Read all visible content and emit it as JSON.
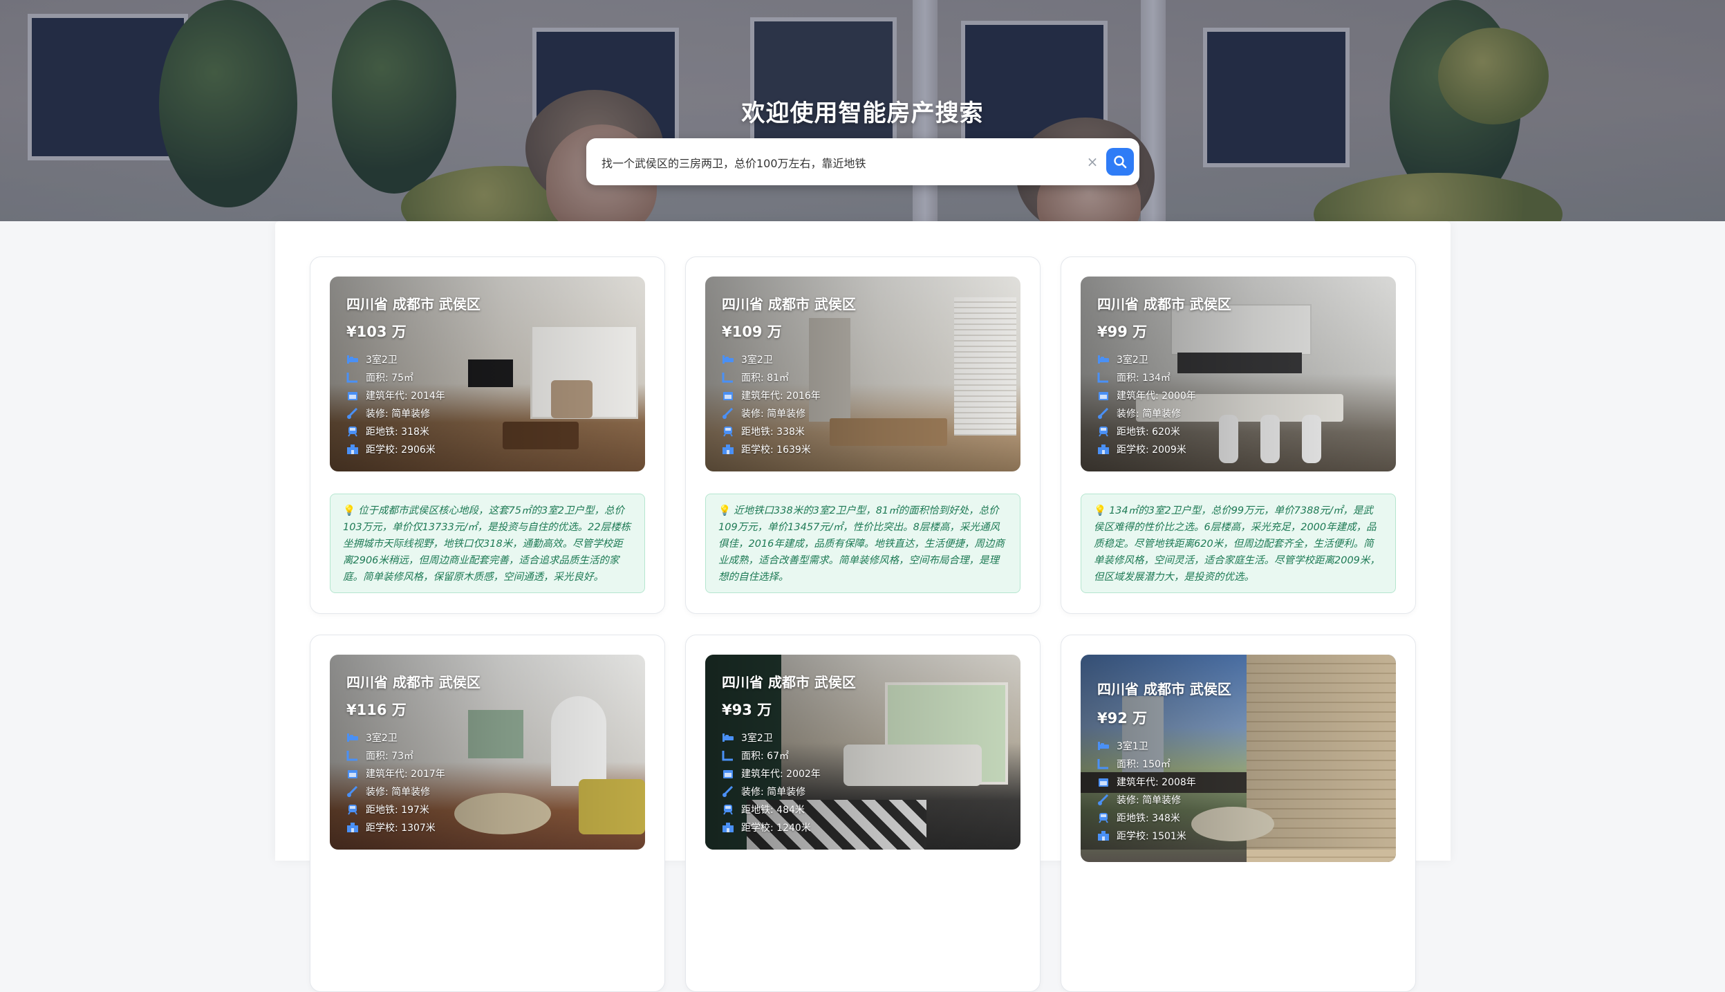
{
  "hero": {
    "title": "欢迎使用智能房产搜索",
    "search_value": "找一个武侯区的三房两卫，总价100万左右，靠近地铁",
    "clear_label": "×"
  },
  "colors": {
    "accent": "#2f7cf6",
    "desc_bg": "#e9f8f1",
    "desc_text": "#1e7a55",
    "icon_blue": "#4a90f5"
  },
  "icons": [
    "bed-icon",
    "area-icon",
    "calendar-icon",
    "brush-icon",
    "subway-icon",
    "school-icon",
    "lightbulb-icon",
    "search-icon",
    "clear-icon"
  ],
  "listings": [
    {
      "location": "四川省 成都市 武侯区",
      "price": "¥103 万",
      "layout": "3室2卫",
      "area": "面积: 75㎡",
      "year": "建筑年代: 2014年",
      "decoration": "装修: 简单装修",
      "metro": "距地铁: 318米",
      "school": "距学校: 2906米",
      "description": "位于成都市武侯区核心地段，这套75㎡的3室2卫户型，总价103万元，单价仅13733元/㎡，是投资与自住的优选。22层楼栋坐拥城市天际线视野，地铁口仅318米，通勤高效。尽管学校距离2906米稍远，但周边商业配套完善，适合追求品质生活的家庭。简单装修风格，保留原木质感，空间通透，采光良好。"
    },
    {
      "location": "四川省 成都市 武侯区",
      "price": "¥109 万",
      "layout": "3室2卫",
      "area": "面积: 81㎡",
      "year": "建筑年代: 2016年",
      "decoration": "装修: 简单装修",
      "metro": "距地铁: 338米",
      "school": "距学校: 1639米",
      "description": "近地铁口338米的3室2卫户型，81㎡的面积恰到好处，总价109万元，单价13457元/㎡，性价比突出。8层楼高，采光通风俱佳，2016年建成，品质有保障。地铁直达，生活便捷，周边商业成熟，适合改善型需求。简单装修风格，空间布局合理，是理想的自住选择。"
    },
    {
      "location": "四川省 成都市 武侯区",
      "price": "¥99 万",
      "layout": "3室2卫",
      "area": "面积: 134㎡",
      "year": "建筑年代: 2000年",
      "decoration": "装修: 简单装修",
      "metro": "距地铁: 620米",
      "school": "距学校: 2009米",
      "description": "134㎡的3室2卫户型，总价99万元，单价7388元/㎡，是武侯区难得的性价比之选。6层楼高，采光充足，2000年建成，品质稳定。尽管地铁距离620米，但周边配套齐全，生活便利。简单装修风格，空间灵活，适合家庭生活。尽管学校距离2009米，但区域发展潜力大，是投资的优选。"
    },
    {
      "location": "四川省 成都市 武侯区",
      "price": "¥116 万",
      "layout": "3室2卫",
      "area": "面积: 73㎡",
      "year": "建筑年代: 2017年",
      "decoration": "装修: 简单装修",
      "metro": "距地铁: 197米",
      "school": "距学校: 1307米"
    },
    {
      "location": "四川省 成都市 武侯区",
      "price": "¥93 万",
      "layout": "3室2卫",
      "area": "面积: 67㎡",
      "year": "建筑年代: 2002年",
      "decoration": "装修: 简单装修",
      "metro": "距地铁: 484米",
      "school": "距学校: 1240米"
    },
    {
      "location": "四川省 成都市 武侯区",
      "price": "¥92 万",
      "layout": "3室1卫",
      "area": "面积: 150㎡",
      "year": "建筑年代: 2008年",
      "decoration": "装修: 简单装修",
      "metro": "距地铁: 348米",
      "school": "距学校: 1501米"
    }
  ]
}
